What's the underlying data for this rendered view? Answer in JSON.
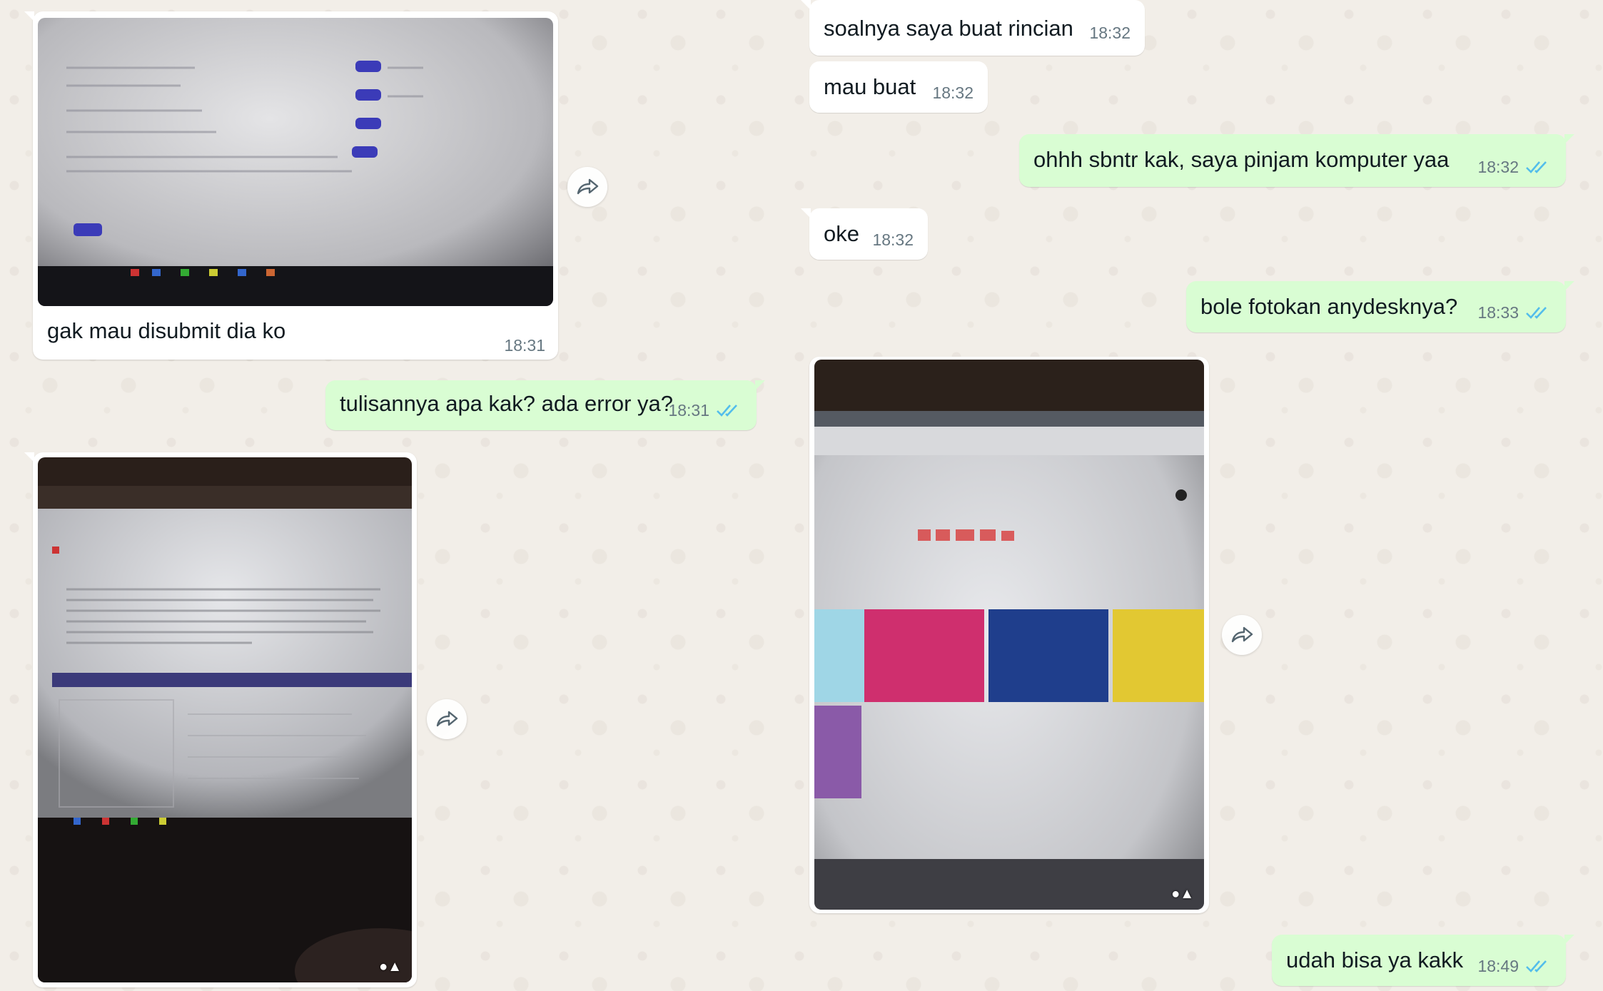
{
  "colors": {
    "incoming_bubble": "#ffffff",
    "outgoing_bubble": "#d9fdd3",
    "read_ticks": "#53bdeb",
    "timestamp": "#667781",
    "chat_background": "#f2eee8"
  },
  "messages": [
    {
      "id": "m1",
      "direction": "incoming",
      "type": "image",
      "caption": "gak mau disubmit dia ko",
      "time": "18:31"
    },
    {
      "id": "m2",
      "direction": "outgoing",
      "type": "text",
      "text": "tulisannya apa kak? ada error ya?",
      "time": "18:31",
      "status": "read"
    },
    {
      "id": "m3",
      "direction": "incoming",
      "type": "image",
      "caption": "",
      "time": ""
    },
    {
      "id": "m4",
      "direction": "incoming",
      "type": "text",
      "text": "soalnya saya buat rincian",
      "time": "18:32"
    },
    {
      "id": "m5",
      "direction": "incoming",
      "type": "text",
      "text": "mau buat",
      "time": "18:32"
    },
    {
      "id": "m6",
      "direction": "outgoing",
      "type": "text",
      "text": "ohhh sbntr kak, saya pinjam komputer yaa",
      "time": "18:32",
      "status": "read"
    },
    {
      "id": "m7",
      "direction": "incoming",
      "type": "text",
      "text": "oke",
      "time": "18:32"
    },
    {
      "id": "m8",
      "direction": "outgoing",
      "type": "text",
      "text": "bole fotokan anydesknya?",
      "time": "18:33",
      "status": "read"
    },
    {
      "id": "m9",
      "direction": "incoming",
      "type": "image",
      "caption": "",
      "time": ""
    },
    {
      "id": "m10",
      "direction": "outgoing",
      "type": "text",
      "text": "udah bisa ya kakk",
      "time": "18:49",
      "status": "read"
    }
  ],
  "icons": {
    "forward": "forward-icon",
    "read_receipt": "double-check-icon"
  }
}
